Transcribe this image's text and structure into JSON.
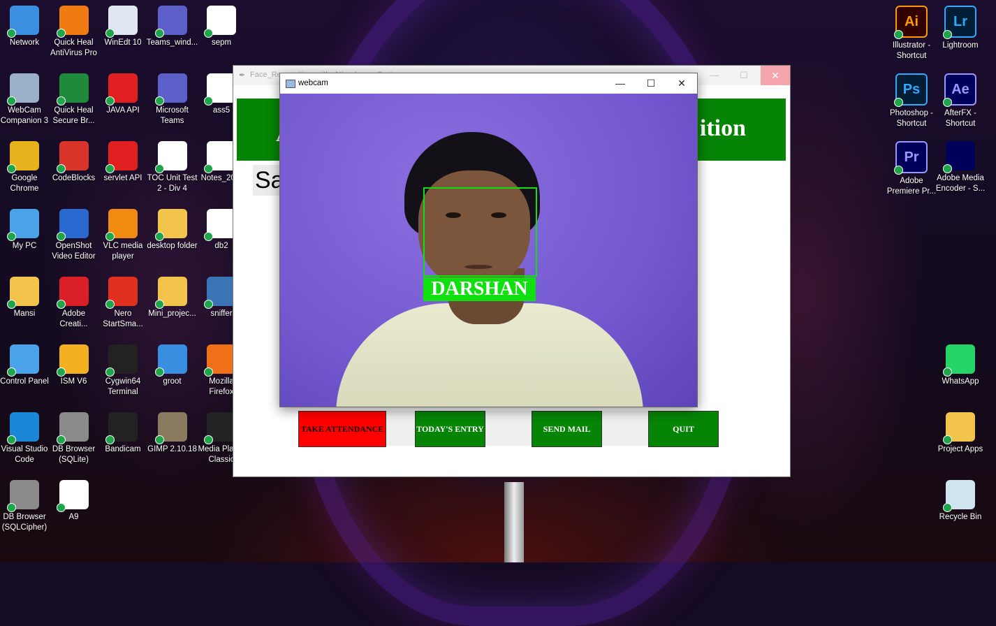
{
  "desktop": {
    "left_icons": [
      {
        "label": "Network",
        "icon": "network-icon",
        "color": "#3b8fe0"
      },
      {
        "label": "Quick Heal AntiVirus Pro",
        "icon": "quickheal-icon",
        "color": "#f07b12"
      },
      {
        "label": "WinEdt 10",
        "icon": "winedt-icon",
        "color": "#dfe6f0"
      },
      {
        "label": "Teams_wind...",
        "icon": "teams-icon",
        "color": "#5b5fc7"
      },
      {
        "label": "sepm",
        "icon": "pdf-icon",
        "color": "#ffffff"
      },
      {
        "label": "WebCam Companion 3",
        "icon": "webcam-icon",
        "color": "#9ab0c8"
      },
      {
        "label": "Quick Heal Secure Br...",
        "icon": "quickheal-browser-icon",
        "color": "#1f8a3a"
      },
      {
        "label": "JAVA API",
        "icon": "oracle-icon",
        "color": "#e02020"
      },
      {
        "label": "Microsoft Teams",
        "icon": "teams-icon",
        "color": "#5b5fc7"
      },
      {
        "label": "ass5",
        "icon": "file-icon",
        "color": "#ffffff"
      },
      {
        "label": "Google Chrome",
        "icon": "chrome-icon",
        "color": "#e8b21d"
      },
      {
        "label": "CodeBlocks",
        "icon": "codeblocks-icon",
        "color": "#d9352b"
      },
      {
        "label": "servlet API",
        "icon": "oracle-icon",
        "color": "#e02020"
      },
      {
        "label": "TOC Unit Test 2 - Div 4",
        "icon": "pdf-icon",
        "color": "#ffffff"
      },
      {
        "label": "Notes_20...",
        "icon": "docx-icon",
        "color": "#ffffff"
      },
      {
        "label": "My PC",
        "icon": "pc-icon",
        "color": "#4aa3e8"
      },
      {
        "label": "OpenShot Video Editor",
        "icon": "openshot-icon",
        "color": "#2a6ad0"
      },
      {
        "label": "VLC media player",
        "icon": "vlc-icon",
        "color": "#f08a10"
      },
      {
        "label": "desktop folder",
        "icon": "folder-icon",
        "color": "#f3c44b"
      },
      {
        "label": "db2",
        "icon": "pdf-icon",
        "color": "#ffffff"
      },
      {
        "label": "Mansi",
        "icon": "user-folder-icon",
        "color": "#f3c44b"
      },
      {
        "label": "Adobe Creati...",
        "icon": "adobe-cc-icon",
        "color": "#da1f26"
      },
      {
        "label": "Nero StartSma...",
        "icon": "nero-icon",
        "color": "#e03020"
      },
      {
        "label": "Mini_projec...",
        "icon": "folder-icon",
        "color": "#f3c44b"
      },
      {
        "label": "sniffer",
        "icon": "python-icon",
        "color": "#3a74b5"
      },
      {
        "label": "Control Panel",
        "icon": "control-panel-icon",
        "color": "#4aa3e8"
      },
      {
        "label": "ISM V6",
        "icon": "ism-icon",
        "color": "#f3b020"
      },
      {
        "label": "Cygwin64 Terminal",
        "icon": "terminal-icon",
        "color": "#222222"
      },
      {
        "label": "groot",
        "icon": "image-icon",
        "color": "#3a8ee0"
      },
      {
        "label": "Mozilla Firefox",
        "icon": "firefox-icon",
        "color": "#f0701a"
      },
      {
        "label": "Visual Studio Code",
        "icon": "vscode-icon",
        "color": "#1a86d6"
      },
      {
        "label": "DB Browser (SQLite)",
        "icon": "database-icon",
        "color": "#8a8a8a"
      },
      {
        "label": "Bandicam",
        "icon": "bandicam-icon",
        "color": "#222222"
      },
      {
        "label": "GIMP 2.10.18",
        "icon": "gimp-icon",
        "color": "#8a7a60"
      },
      {
        "label": "Media Player Classic",
        "icon": "mpc-icon",
        "color": "#222222"
      },
      {
        "label": "DB Browser (SQLCipher)",
        "icon": "database-icon",
        "color": "#8a8a8a"
      },
      {
        "label": "A9",
        "icon": "c-file-icon",
        "color": "#ffffff"
      }
    ],
    "right_icons": [
      {
        "label": "Illustrator - Shortcut",
        "icon": "illustrator-icon",
        "color": "#330000",
        "glyph": "Ai",
        "fg": "#ff9a00"
      },
      {
        "label": "Lightroom",
        "icon": "lightroom-icon",
        "color": "#001e36",
        "glyph": "Lr",
        "fg": "#31a8ff"
      },
      {
        "label": "Photoshop - Shortcut",
        "icon": "photoshop-icon",
        "color": "#001e36",
        "glyph": "Ps",
        "fg": "#31a8ff"
      },
      {
        "label": "AfterFX - Shortcut",
        "icon": "aftereffects-icon",
        "color": "#00005b",
        "glyph": "Ae",
        "fg": "#9999ff"
      },
      {
        "label": "Adobe Premiere Pr...",
        "icon": "premiere-icon",
        "color": "#00005b",
        "glyph": "Pr",
        "fg": "#9999ff"
      },
      {
        "label": "Adobe Media Encoder - S...",
        "icon": "media-encoder-icon",
        "color": "#00005b",
        "glyph": "",
        "fg": "#9999ff"
      },
      {
        "label": "WhatsApp",
        "icon": "whatsapp-icon",
        "color": "#25d366",
        "glyph": "",
        "fg": "#ffffff"
      },
      {
        "label": "Project Apps",
        "icon": "folder-icon",
        "color": "#f3c44b",
        "glyph": "",
        "fg": "#ffffff"
      },
      {
        "label": "Recycle Bin",
        "icon": "recycle-bin-icon",
        "color": "#cfe3f0",
        "glyph": "",
        "fg": "#ffffff"
      }
    ]
  },
  "app_window": {
    "title": "Face_Recognition_with_Attendance_System",
    "header_left": "A",
    "header_right": "ition",
    "partial_text": "Sa",
    "buttons": [
      {
        "label": "TAKE ATTENDANCE",
        "bg": "#ff0000",
        "fg": "#111111"
      },
      {
        "label": "TODAY'S ENTRY",
        "bg": "#068406",
        "fg": "#ffffff"
      },
      {
        "label": "SEND MAIL",
        "bg": "#068406",
        "fg": "#ffffff"
      },
      {
        "label": "QUIT",
        "bg": "#068406",
        "fg": "#ffffff"
      }
    ]
  },
  "webcam_window": {
    "title": "webcam",
    "recognized_name": "DARSHAN",
    "box_color": "#10e010"
  }
}
